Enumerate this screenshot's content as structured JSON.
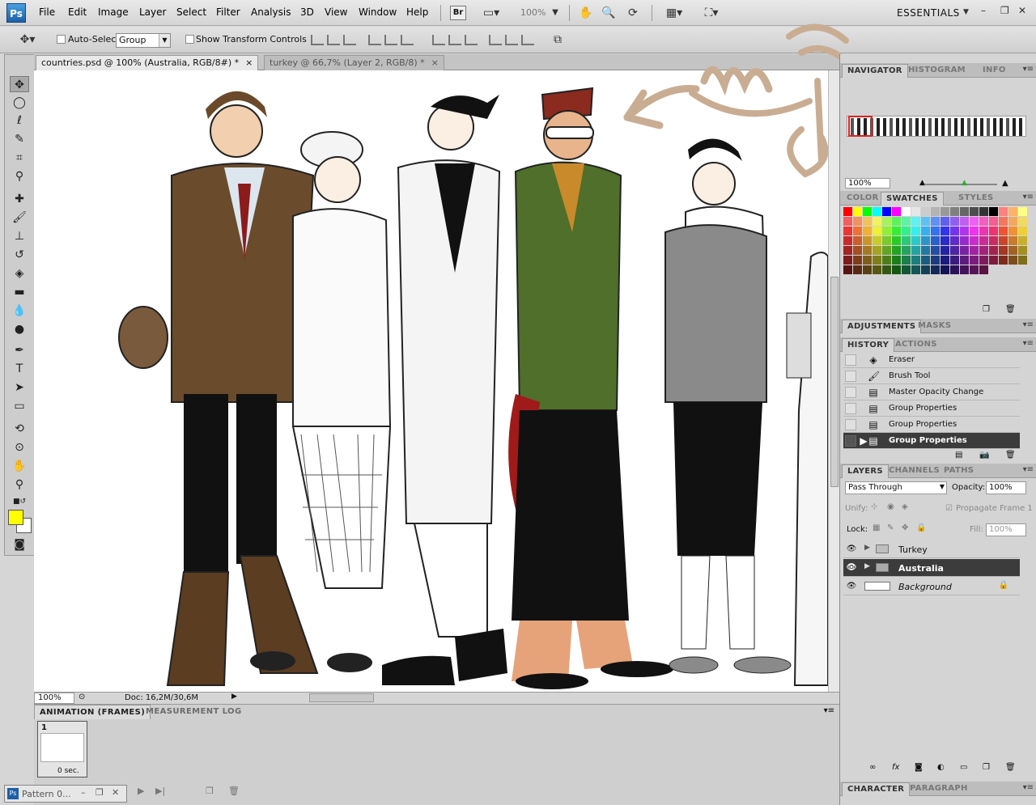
{
  "menubar": {
    "app_logo": "Ps",
    "items": [
      "File",
      "Edit",
      "Image",
      "Layer",
      "Select",
      "Filter",
      "Analysis",
      "3D",
      "View",
      "Window",
      "Help"
    ],
    "bridge_label": "Br",
    "zoom": "100%",
    "workspace": "ESSENTIALS"
  },
  "options": {
    "auto_select_label": "Auto-Select:",
    "auto_select_value": "Group",
    "show_transform_label": "Show Transform Controls"
  },
  "tabs": [
    {
      "label": "countries.psd @ 100% (Australia, RGB/8#) *",
      "close": "×"
    },
    {
      "label": "turkey @ 66,7% (Layer 2, RGB/8) *",
      "close": "×"
    }
  ],
  "statusbar": {
    "zoom": "100%",
    "doc": "Doc: 16,2M/30,6M"
  },
  "animation": {
    "tabs": [
      "ANIMATION (FRAMES)",
      "MEASUREMENT LOG"
    ],
    "frame_number": "1",
    "frame_delay": "0 sec.",
    "minimized_doc": "Pattern 0..."
  },
  "panels": {
    "navigator_tabs": [
      "NAVIGATOR",
      "HISTOGRAM",
      "INFO"
    ],
    "navigator_zoom": "100%",
    "color_tabs": [
      "COLOR",
      "SWATCHES",
      "STYLES"
    ],
    "adjust_tabs": [
      "ADJUSTMENTS",
      "MASKS"
    ],
    "history_tabs": [
      "HISTORY",
      "ACTIONS"
    ],
    "history": [
      {
        "label": "Eraser",
        "icon": "eraser-icon"
      },
      {
        "label": "Brush Tool",
        "icon": "brush-icon"
      },
      {
        "label": "Master Opacity Change",
        "icon": "doc-icon"
      },
      {
        "label": "Group Properties",
        "icon": "doc-icon"
      },
      {
        "label": "Group Properties",
        "icon": "doc-icon"
      },
      {
        "label": "Group Properties",
        "icon": "doc-icon"
      }
    ],
    "layers_tabs": [
      "LAYERS",
      "CHANNELS",
      "PATHS"
    ],
    "blend_mode": "Pass Through",
    "opacity_label": "Opacity:",
    "opacity": "100%",
    "unify_label": "Unify:",
    "propagate": "Propagate Frame 1",
    "lock_label": "Lock:",
    "fill_label": "Fill:",
    "fill": "100%",
    "layers": [
      {
        "name": "Turkey",
        "selected": false
      },
      {
        "name": "Australia",
        "selected": true
      },
      {
        "name": "Background",
        "selected": false
      }
    ],
    "char_tabs": [
      "CHARACTER",
      "PARAGRAPH"
    ]
  },
  "colors": {
    "foreground": "#ffff00",
    "background": "#ffffff",
    "selection": "#3c3c3c"
  }
}
